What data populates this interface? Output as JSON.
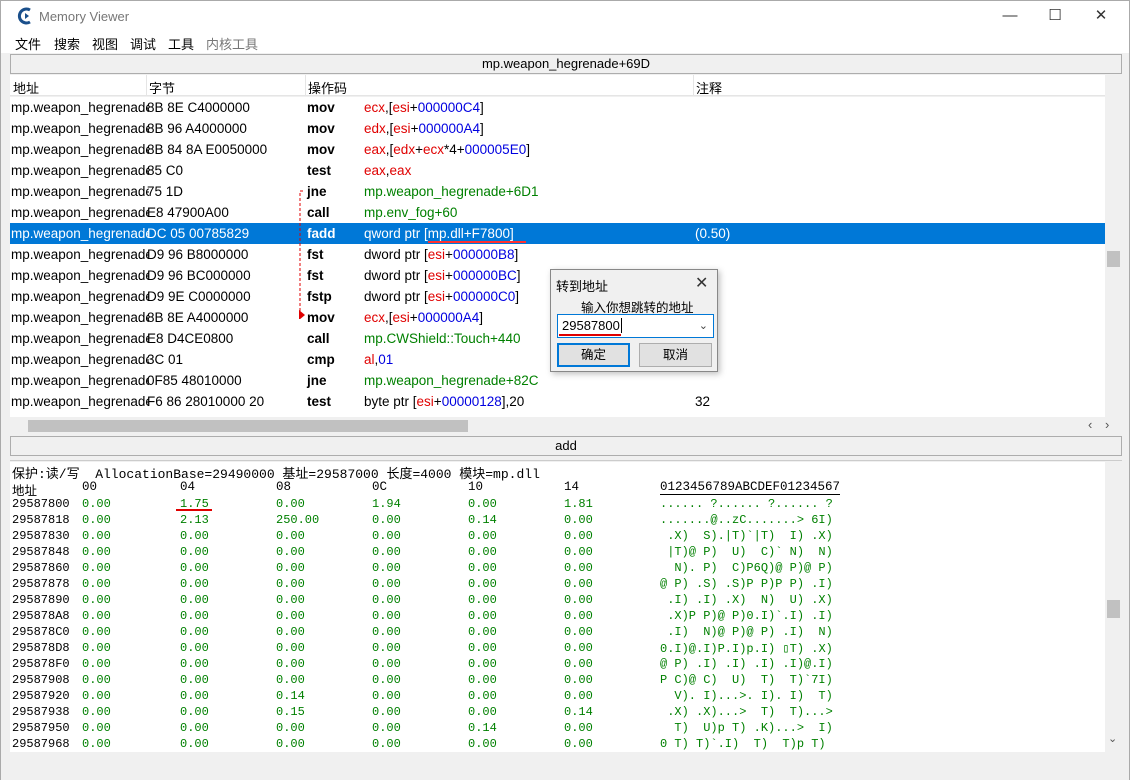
{
  "window": {
    "title": "Memory Viewer",
    "minimize": "—",
    "maximize": "☐",
    "close": "✕"
  },
  "menu": [
    "文件",
    "搜索",
    "视图",
    "调试",
    "工具",
    "内核工具"
  ],
  "address_bar": "mp.weapon_hegrenade+69D",
  "columns": {
    "address": "地址",
    "bytes": "字节",
    "opcode": "操作码",
    "comment": "注释"
  },
  "disasm": [
    {
      "addr": "mp.weapon_hegrenade+",
      "bytes": "8B 8E C4000000",
      "op": "mov",
      "args": [
        [
          "red",
          "ecx"
        ],
        [
          "k",
          ",["
        ],
        [
          "red",
          "esi"
        ],
        [
          "k",
          "+"
        ],
        [
          "blue",
          "000000C4"
        ],
        [
          "k",
          "]"
        ]
      ],
      "comment": ""
    },
    {
      "addr": "mp.weapon_hegrenade+",
      "bytes": "8B 96 A4000000",
      "op": "mov",
      "args": [
        [
          "red",
          "edx"
        ],
        [
          "k",
          ",["
        ],
        [
          "red",
          "esi"
        ],
        [
          "k",
          "+"
        ],
        [
          "blue",
          "000000A4"
        ],
        [
          "k",
          "]"
        ]
      ],
      "comment": ""
    },
    {
      "addr": "mp.weapon_hegrenade+",
      "bytes": "8B 84 8A E0050000",
      "op": "mov",
      "args": [
        [
          "red",
          "eax"
        ],
        [
          "k",
          ",["
        ],
        [
          "red",
          "edx"
        ],
        [
          "k",
          "+"
        ],
        [
          "red",
          "ecx"
        ],
        [
          "k",
          "*4+"
        ],
        [
          "blue",
          "000005E0"
        ],
        [
          "k",
          "]"
        ]
      ],
      "comment": ""
    },
    {
      "addr": "mp.weapon_hegrenade+",
      "bytes": "85 C0",
      "op": "test",
      "args": [
        [
          "red",
          "eax"
        ],
        [
          "k",
          ","
        ],
        [
          "red",
          "eax"
        ]
      ],
      "comment": ""
    },
    {
      "addr": "mp.weapon_hegrenade+",
      "bytes": "75 1D",
      "op": "jne",
      "args": [
        [
          "green",
          "mp.weapon_hegrenade+6D1"
        ]
      ],
      "comment": ""
    },
    {
      "addr": "mp.weapon_hegrenade+",
      "bytes": "E8 47900A00",
      "op": "call",
      "args": [
        [
          "green",
          "mp.env_fog+60"
        ]
      ],
      "comment": ""
    },
    {
      "addr": "mp.weapon_hegrenade+",
      "bytes": "DC 05 00785829",
      "op": "fadd",
      "args": [
        [
          "k",
          "qword ptr ["
        ],
        [
          "green",
          "mp.dll+F7800"
        ],
        [
          "k",
          "]"
        ]
      ],
      "comment": "(0.50)",
      "sel": true
    },
    {
      "addr": "mp.weapon_hegrenade+",
      "bytes": "D9 96 B8000000",
      "op": "fst",
      "args": [
        [
          "k",
          "dword ptr ["
        ],
        [
          "red",
          "esi"
        ],
        [
          "k",
          "+"
        ],
        [
          "blue",
          "000000B8"
        ],
        [
          "k",
          "]"
        ]
      ],
      "comment": ""
    },
    {
      "addr": "mp.weapon_hegrenade+",
      "bytes": "D9 96 BC000000",
      "op": "fst",
      "args": [
        [
          "k",
          "dword ptr ["
        ],
        [
          "red",
          "esi"
        ],
        [
          "k",
          "+"
        ],
        [
          "blue",
          "000000BC"
        ],
        [
          "k",
          "]"
        ]
      ],
      "comment": ""
    },
    {
      "addr": "mp.weapon_hegrenade+",
      "bytes": "D9 9E C0000000",
      "op": "fstp",
      "args": [
        [
          "k",
          "dword ptr ["
        ],
        [
          "red",
          "esi"
        ],
        [
          "k",
          "+"
        ],
        [
          "blue",
          "000000C0"
        ],
        [
          "k",
          "]"
        ]
      ],
      "comment": ""
    },
    {
      "addr": "mp.weapon_hegrenade+",
      "bytes": "8B 8E A4000000",
      "op": "mov",
      "args": [
        [
          "red",
          "ecx"
        ],
        [
          "k",
          ",["
        ],
        [
          "red",
          "esi"
        ],
        [
          "k",
          "+"
        ],
        [
          "blue",
          "000000A4"
        ],
        [
          "k",
          "]"
        ]
      ],
      "comment": ""
    },
    {
      "addr": "mp.weapon_hegrenade+",
      "bytes": "E8 D4CE0800",
      "op": "call",
      "args": [
        [
          "green",
          "mp.CWShield::Touch+440"
        ]
      ],
      "comment": ""
    },
    {
      "addr": "mp.weapon_hegrenade+",
      "bytes": "3C 01",
      "op": "cmp",
      "args": [
        [
          "red",
          "al"
        ],
        [
          "k",
          ","
        ],
        [
          "blue",
          "01"
        ]
      ],
      "comment": ""
    },
    {
      "addr": "mp.weapon_hegrenade+",
      "bytes": "0F85 48010000",
      "op": "jne",
      "args": [
        [
          "green",
          "mp.weapon_hegrenade+82C"
        ]
      ],
      "comment": ""
    },
    {
      "addr": "mp.weapon_hegrenade+",
      "bytes": "F6 86 28010000 20",
      "op": "test",
      "args": [
        [
          "k",
          "byte ptr ["
        ],
        [
          "red",
          "esi"
        ],
        [
          "k",
          "+"
        ],
        [
          "blue",
          "00000128"
        ],
        [
          "k",
          "],20"
        ]
      ],
      "comment": "32"
    }
  ],
  "add_button": "add",
  "hex": {
    "info": "保护:读/写  AllocationBase=29490000 基址=29587000 长度=4000 模块=mp.dll",
    "header_addr": "地址",
    "header_cols": [
      "00",
      "04",
      "08",
      "0C",
      "10",
      "14"
    ],
    "header_ascii": "0123456789ABCDEF01234567",
    "rows": [
      {
        "a": "29587800",
        "v": [
          "0.00",
          "1.75",
          "0.00",
          "1.94",
          "0.00",
          "1.81"
        ],
        "s": "...... ?...... ?...... ?"
      },
      {
        "a": "29587818",
        "v": [
          "0.00",
          "2.13",
          "250.00",
          "0.00",
          "0.14",
          "0.00"
        ],
        "s": ".......@..zC.......> 6I)"
      },
      {
        "a": "29587830",
        "v": [
          "0.00",
          "0.00",
          "0.00",
          "0.00",
          "0.00",
          "0.00"
        ],
        "s": " .X)  S).|T)`|T)  I) .X)"
      },
      {
        "a": "29587848",
        "v": [
          "0.00",
          "0.00",
          "0.00",
          "0.00",
          "0.00",
          "0.00"
        ],
        "s": " |T)@ P)  U)  C)` N)  N)"
      },
      {
        "a": "29587860",
        "v": [
          "0.00",
          "0.00",
          "0.00",
          "0.00",
          "0.00",
          "0.00"
        ],
        "s": "  N). P)  C)P6Q)@ P)@ P)"
      },
      {
        "a": "29587878",
        "v": [
          "0.00",
          "0.00",
          "0.00",
          "0.00",
          "0.00",
          "0.00"
        ],
        "s": "@ P) .S) .S)P P)P P) .I)"
      },
      {
        "a": "29587890",
        "v": [
          "0.00",
          "0.00",
          "0.00",
          "0.00",
          "0.00",
          "0.00"
        ],
        "s": " .I) .I) .X)  N)  U) .X)"
      },
      {
        "a": "295878A8",
        "v": [
          "0.00",
          "0.00",
          "0.00",
          "0.00",
          "0.00",
          "0.00"
        ],
        "s": " .X)P P)@ P)0.I)`.I) .I)"
      },
      {
        "a": "295878C0",
        "v": [
          "0.00",
          "0.00",
          "0.00",
          "0.00",
          "0.00",
          "0.00"
        ],
        "s": " .I)  N)@ P)@ P) .I)  N)"
      },
      {
        "a": "295878D8",
        "v": [
          "0.00",
          "0.00",
          "0.00",
          "0.00",
          "0.00",
          "0.00"
        ],
        "s": "0.I)@.I)P.I)p.I) ▯T) .X)"
      },
      {
        "a": "295878F0",
        "v": [
          "0.00",
          "0.00",
          "0.00",
          "0.00",
          "0.00",
          "0.00"
        ],
        "s": "@ P) .I) .I) .I) .I)@.I)"
      },
      {
        "a": "29587908",
        "v": [
          "0.00",
          "0.00",
          "0.00",
          "0.00",
          "0.00",
          "0.00"
        ],
        "s": "P C)@ C)  U)  T)  T)`7I)"
      },
      {
        "a": "29587920",
        "v": [
          "0.00",
          "0.00",
          "0.14",
          "0.00",
          "0.00",
          "0.00"
        ],
        "s": "  V). I)...>. I). I)  T)"
      },
      {
        "a": "29587938",
        "v": [
          "0.00",
          "0.00",
          "0.15",
          "0.00",
          "0.00",
          "0.14"
        ],
        "s": " .X) .X)...>  T)  T)...>"
      },
      {
        "a": "29587950",
        "v": [
          "0.00",
          "0.00",
          "0.00",
          "0.00",
          "0.14",
          "0.00"
        ],
        "s": "  T)  U)p T) .K)...>  I)"
      },
      {
        "a": "29587968",
        "v": [
          "0.00",
          "0.00",
          "0.00",
          "0.00",
          "0.00",
          "0.00"
        ],
        "s": "0 T) T)`.I)  T)  T)p T)"
      }
    ]
  },
  "dialog": {
    "title": "转到地址",
    "label": "输入你想跳转的地址",
    "value": "29587800",
    "ok": "确定",
    "cancel": "取消",
    "close": "✕"
  }
}
